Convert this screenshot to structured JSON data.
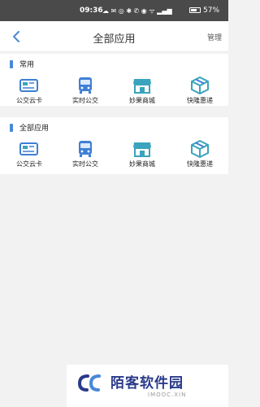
{
  "status": {
    "time": "09:36",
    "icons": "☁ ✉ ◎ ✱ ✆ ◉ ᯤ ▂▄▆",
    "battery": "57%"
  },
  "header": {
    "title": "全部应用",
    "manage": "管理"
  },
  "sections": [
    {
      "title": "常用",
      "apps": [
        {
          "label": "公交云卡",
          "icon": "bus-card-icon"
        },
        {
          "label": "实时公交",
          "icon": "bus-icon"
        },
        {
          "label": "妙果商城",
          "icon": "shop-icon"
        },
        {
          "label": "快隆惠递",
          "icon": "package-icon"
        }
      ]
    },
    {
      "title": "全部应用",
      "apps": [
        {
          "label": "公交云卡",
          "icon": "bus-card-icon"
        },
        {
          "label": "实时公交",
          "icon": "bus-icon"
        },
        {
          "label": "妙果商城",
          "icon": "shop-icon"
        },
        {
          "label": "快隆惠递",
          "icon": "package-icon"
        }
      ]
    }
  ],
  "watermark": {
    "name": "陌客软件园",
    "domain": "IMOOC.XIN"
  },
  "colors": {
    "accent": "#4a88d8",
    "icon_blue": "#3e7fd6",
    "icon_teal": "#3aa3bd"
  }
}
